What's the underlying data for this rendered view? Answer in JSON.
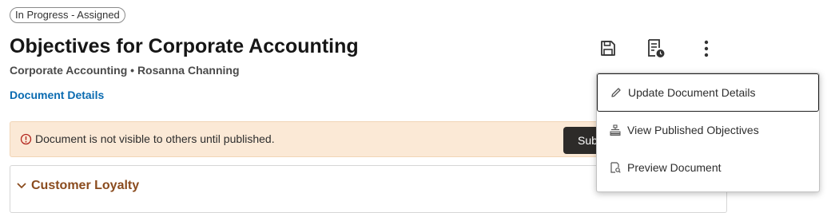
{
  "status": {
    "label": "In Progress - Assigned"
  },
  "header": {
    "title": "Objectives for Corporate Accounting",
    "subtitle": "Corporate Accounting • Rosanna Channing",
    "details_link": "Document Details"
  },
  "toolbar": {
    "save_icon": "save-icon",
    "history_icon": "document-history-icon",
    "more_icon": "more-vertical-icon"
  },
  "banner": {
    "text": "Document is not visible to others until published.",
    "button_label": "Sub"
  },
  "section": {
    "title": "Customer Loyalty"
  },
  "menu": {
    "items": [
      {
        "label": "Update Document Details",
        "icon": "pencil-icon"
      },
      {
        "label": "View Published Objectives",
        "icon": "hierarchy-icon"
      },
      {
        "label": "Preview Document",
        "icon": "preview-document-icon"
      }
    ]
  },
  "colors": {
    "link": "#0a6bb1",
    "banner_bg": "#fbe9d6",
    "section_title": "#8a4b1e",
    "warning_icon": "#b3261e"
  }
}
